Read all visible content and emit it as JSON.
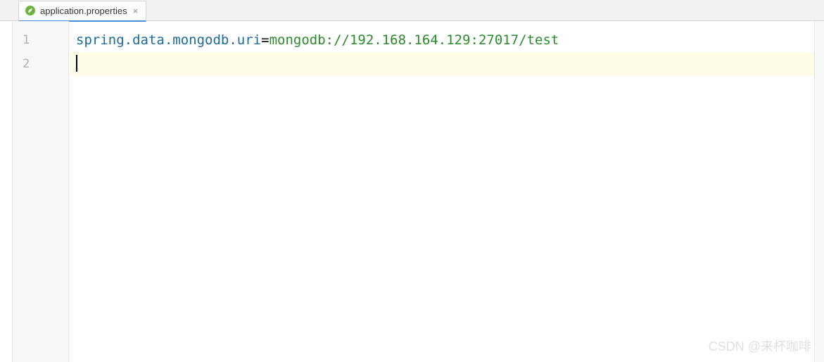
{
  "tab": {
    "filename": "application.properties",
    "icon": "spring-leaf-icon"
  },
  "editor": {
    "lines": [
      {
        "number": "1",
        "key": "spring.data.mongodb.uri",
        "equals": "=",
        "value": "mongodb://192.168.164.129:27017/test",
        "current": false
      },
      {
        "number": "2",
        "key": "",
        "equals": "",
        "value": "",
        "current": true
      }
    ]
  },
  "watermark": "CSDN @来杯咖啡"
}
